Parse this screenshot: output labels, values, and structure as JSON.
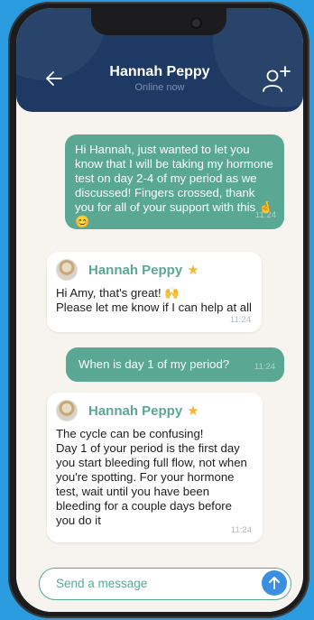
{
  "chat": {
    "contact_name": "Hannah Peppy",
    "contact_status": "Online now"
  },
  "messages": [
    {
      "direction": "out",
      "text": "Hi Hannah, just wanted to let you know that I will be taking my hormone test on day 2-4 of my period as we discussed! Fingers crossed, thank you for all of your support with this 🤞 😊",
      "time": "11:24"
    },
    {
      "direction": "in",
      "sender": "Hannah Peppy",
      "text": "Hi Amy, that's great! 🙌\nPlease let me know if I can help at all",
      "time": "11:24"
    },
    {
      "direction": "out",
      "text": "When is day 1 of my period?",
      "time": "11:24"
    },
    {
      "direction": "in",
      "sender": "Hannah Peppy",
      "text": "The cycle can be confusing!\nDay 1 of your period is the first day you start bleeding full flow, not when you're spotting. For your hormone test, wait until you have been bleeding for a couple days before you do it",
      "time": "11:24"
    }
  ],
  "composer": {
    "placeholder": "Send a message"
  },
  "colors": {
    "header": "#1e3a64",
    "accent": "#5aa894",
    "send": "#3a8fe0",
    "star": "#f2b632",
    "background": "#f7f4ef"
  },
  "icons": [
    "back-arrow-icon",
    "add-user-icon",
    "star-icon",
    "send-arrow-icon"
  ]
}
